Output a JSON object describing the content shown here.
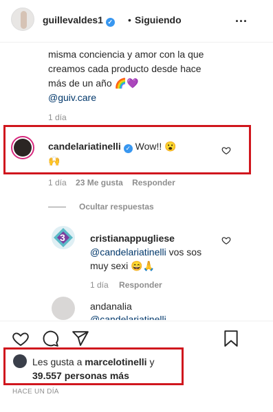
{
  "header": {
    "username": "guillevaldes1",
    "separator": "•",
    "follow_status": "Siguiendo",
    "more": "...",
    "verified_mark": "✓"
  },
  "caption": {
    "line1": "misma conciencia y amor con la que",
    "line2": "creamos cada producto desde hace",
    "line3": "más de un año",
    "emojis": "🌈💜",
    "mention": "@guiv.care",
    "time": "1 día"
  },
  "comments": [
    {
      "username": "candelariatinelli",
      "verified_mark": "✓",
      "text": "Wow!!",
      "emoji_inline": "😮",
      "emoji_line2": "🙌",
      "time": "1 día",
      "likes": "23 Me gusta",
      "reply": "Responder"
    }
  ],
  "replies_toggle": "Ocultar respuestas",
  "replies": [
    {
      "username": "cristianappugliese",
      "mention": "@candelariatinelli",
      "text_after_mention": " vos sos",
      "line2": "muy sexi",
      "emojis": "😄🙏",
      "time": "1 día",
      "reply": "Responder",
      "avatar_glyph": "3"
    },
    {
      "username": "andanalia",
      "partial": "@candelariatinelli"
    }
  ],
  "likes_summary": {
    "prefix": "Les gusta a",
    "user": "marcelotinelli",
    "connector": "y",
    "count": "39.557 personas más"
  },
  "timestamp": "HACE UN DÍA",
  "icons": [
    "heart-icon",
    "comment-icon",
    "share-icon",
    "bookmark-icon"
  ],
  "colors": {
    "highlight_red": "#d0161d",
    "verified_blue": "#3897f0",
    "link_blue": "#00376b",
    "meta_gray": "#8e8e8e"
  }
}
